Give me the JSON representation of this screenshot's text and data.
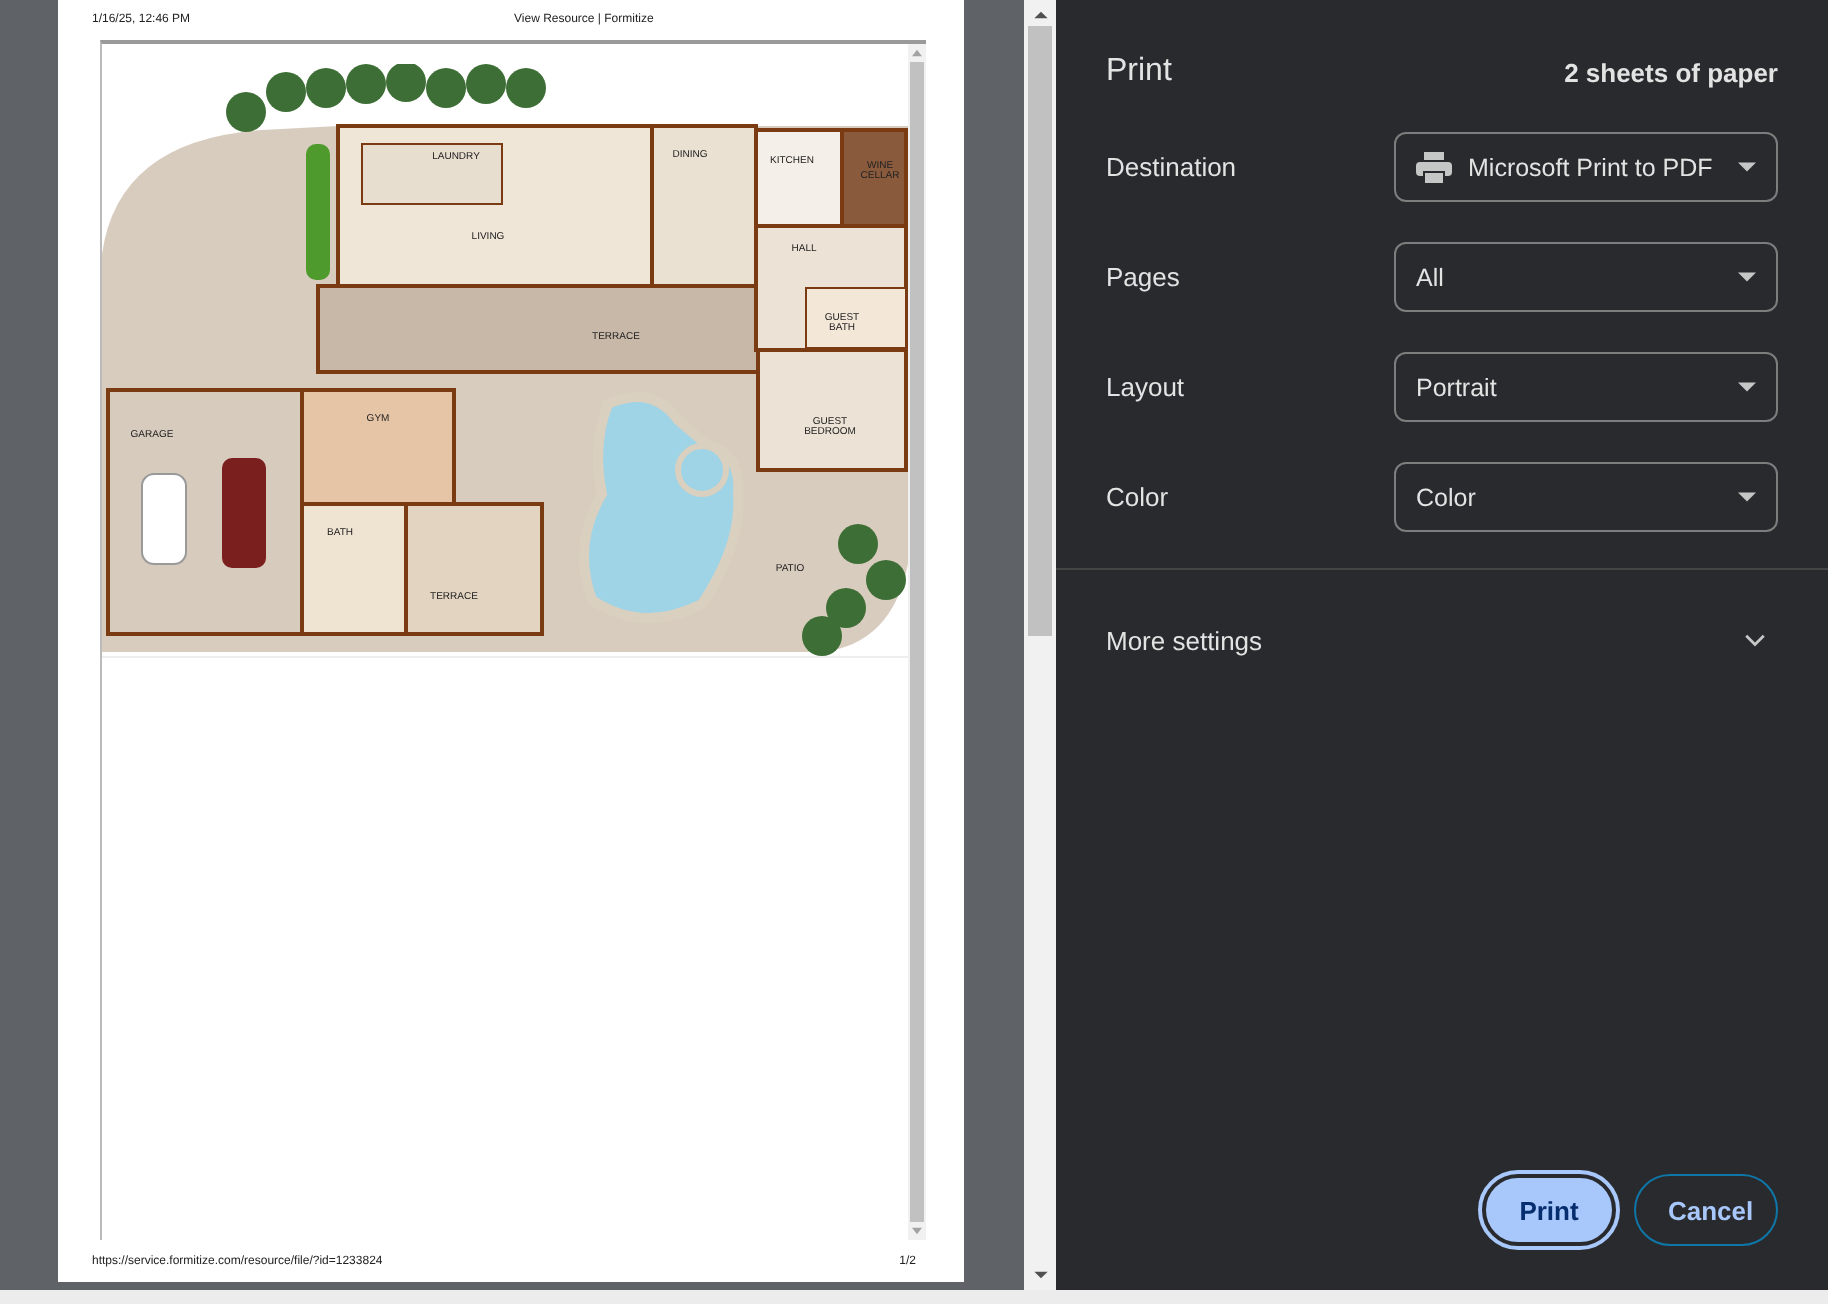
{
  "preview": {
    "header_left": "1/16/25, 12:46 PM",
    "header_center": "View Resource | Formitize",
    "footer_left": "https://service.formitize.com/resource/file/?id=1233824",
    "footer_right": "1/2",
    "floor_plan": {
      "rooms": [
        {
          "label": "LAUNDRY"
        },
        {
          "label": "LIVING"
        },
        {
          "label": "DINING"
        },
        {
          "label": "KITCHEN"
        },
        {
          "label": "WINE CELLAR"
        },
        {
          "label": "HALL"
        },
        {
          "label": "GUEST BATH"
        },
        {
          "label": "TERRACE"
        },
        {
          "label": "GUEST BEDROOM"
        },
        {
          "label": "GARAGE"
        },
        {
          "label": "GYM"
        },
        {
          "label": "BATH"
        },
        {
          "label": "TERRACE"
        },
        {
          "label": "PATIO"
        }
      ]
    }
  },
  "panel": {
    "title": "Print",
    "sheets": "2 sheets of paper",
    "settings": [
      {
        "label": "Destination",
        "kind": "device",
        "value": "Microsoft Print to PDF"
      },
      {
        "label": "Pages",
        "kind": "option",
        "value": "All"
      },
      {
        "label": "Layout",
        "kind": "option",
        "value": "Portrait"
      },
      {
        "label": "Color",
        "kind": "option",
        "value": "Color"
      }
    ],
    "more_settings": {
      "label": "More settings",
      "expanded": false
    },
    "buttons": [
      {
        "label": "Print",
        "kind": "primary"
      },
      {
        "label": "Cancel",
        "kind": "secondary"
      }
    ]
  }
}
